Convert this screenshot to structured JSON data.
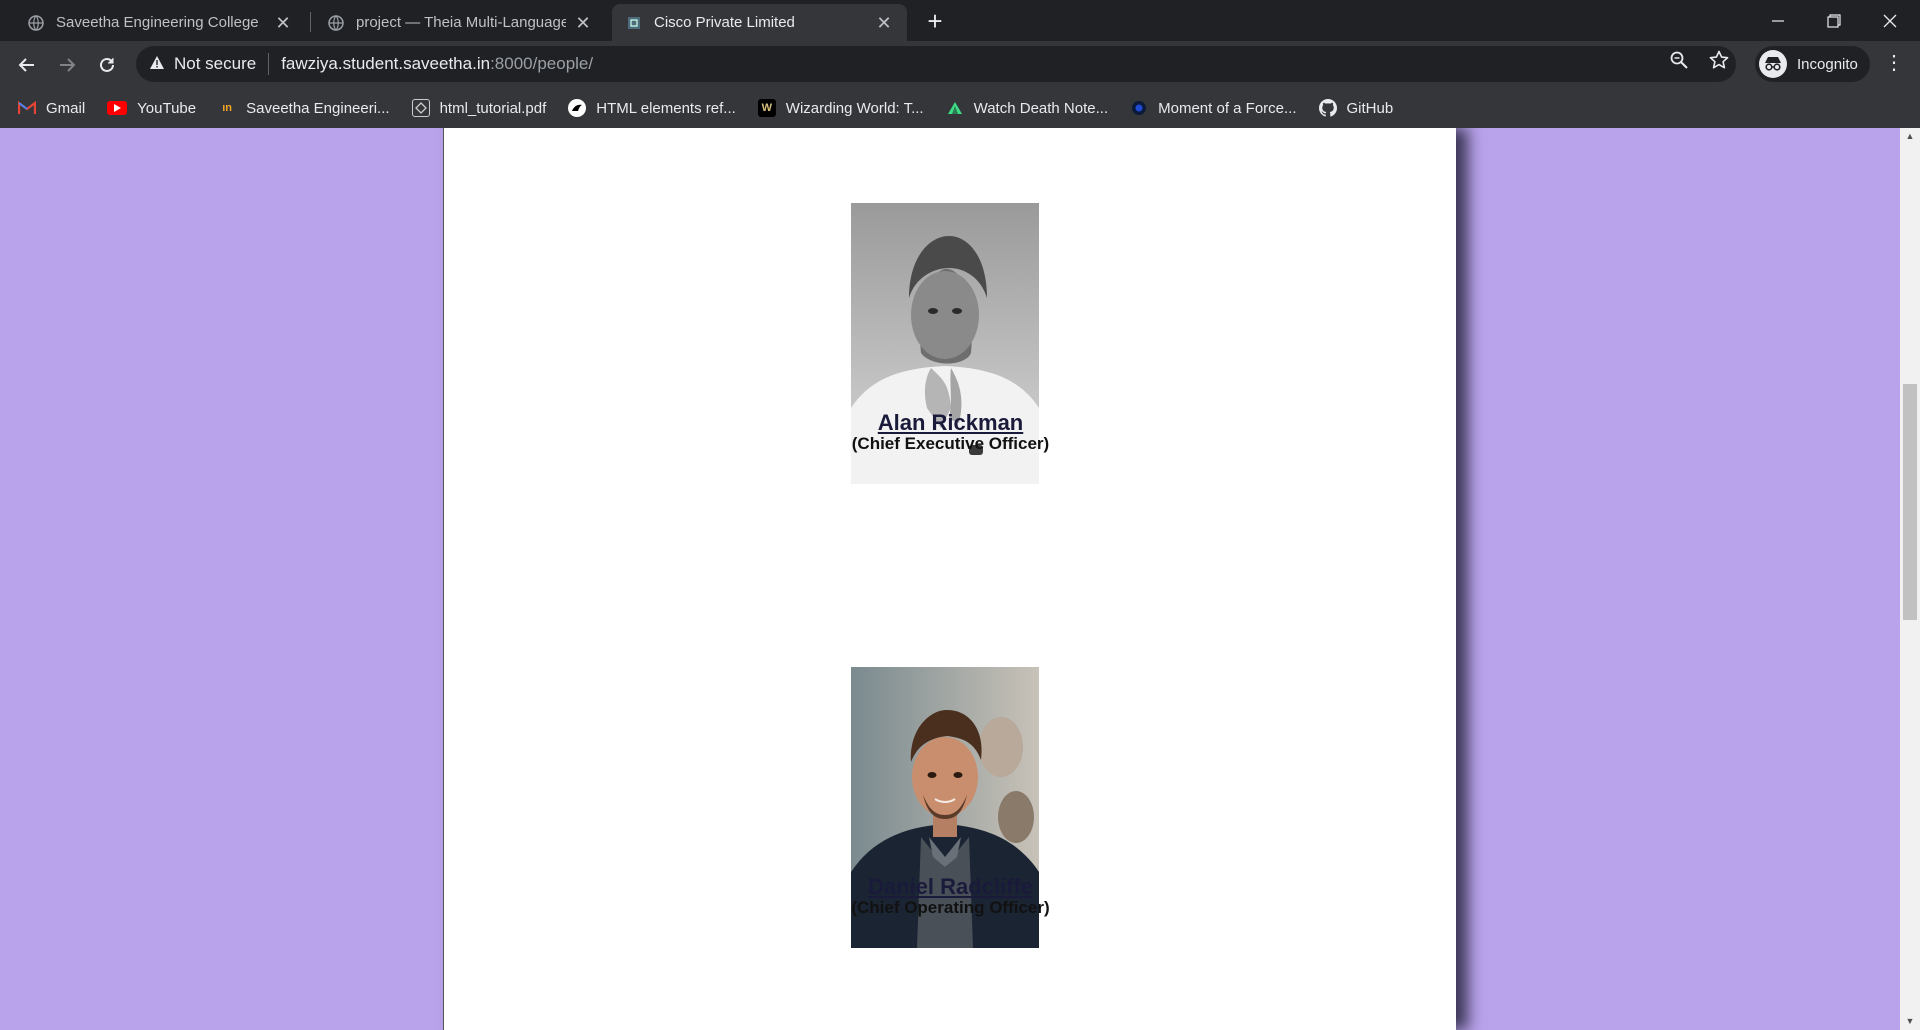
{
  "browser": {
    "tabs": [
      {
        "title": "Saveetha Engineering College",
        "active": false
      },
      {
        "title": "project — Theia Multi-Language",
        "active": false
      },
      {
        "title": "Cisco Private Limited",
        "active": true
      }
    ],
    "new_tab": "+",
    "window_controls": {
      "minimize": "minimize-icon",
      "restore": "restore-icon",
      "close": "close-icon"
    }
  },
  "toolbar": {
    "security_label": "Not secure",
    "url_host": "fawziya.student.saveetha.in",
    "url_path": ":8000/people/",
    "profile_label": "Incognito"
  },
  "bookmarks": [
    {
      "label": "Gmail",
      "icon": "gmail-icon",
      "color": "#ea4335"
    },
    {
      "label": "YouTube",
      "icon": "youtube-icon",
      "color": "#ff0000"
    },
    {
      "label": "Saveetha Engineeri...",
      "icon": "saveetha-icon",
      "color": "#f5a623"
    },
    {
      "label": "html_tutorial.pdf",
      "icon": "pdf-icon",
      "color": "#cccccc"
    },
    {
      "label": "HTML elements ref...",
      "icon": "mdn-icon",
      "color": "#ffffff"
    },
    {
      "label": "Wizarding World: T...",
      "icon": "wizarding-icon",
      "color": "#000000"
    },
    {
      "label": "Watch Death Note...",
      "icon": "deathnote-icon",
      "color": "#3ddc84"
    },
    {
      "label": "Moment of a Force...",
      "icon": "moment-icon",
      "color": "#1a3a8a"
    },
    {
      "label": "GitHub",
      "icon": "github-icon",
      "color": "#ffffff"
    }
  ],
  "page": {
    "background_color": "#b9a3eb",
    "people": [
      {
        "name": "Alan Rickman",
        "role": "(Chief Executive Officer)",
        "photo": "alan-rickman-photo"
      },
      {
        "name": "Daniel Radcliffe",
        "role": "(Chief Operating Officer)",
        "photo": "daniel-radcliffe-photo"
      }
    ]
  }
}
